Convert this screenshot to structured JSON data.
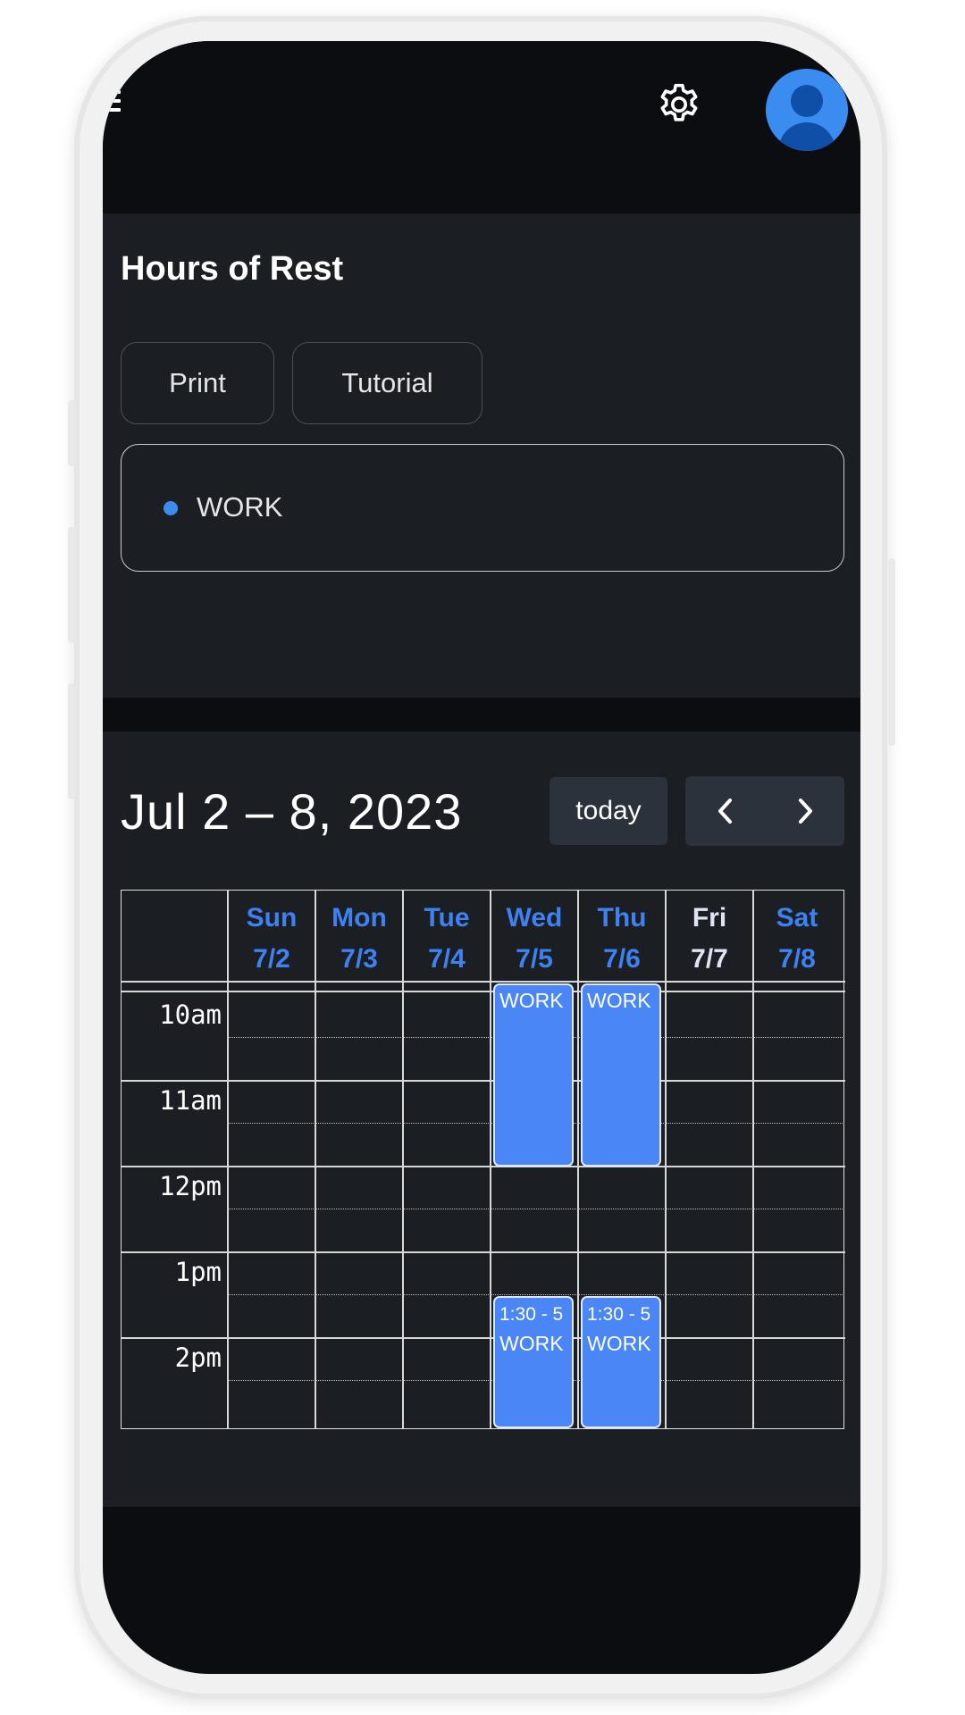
{
  "header": {
    "menu_icon": "hamburger-icon",
    "settings_icon": "gear-icon",
    "avatar_icon": "user-avatar-icon"
  },
  "page": {
    "title": "Hours of Rest",
    "buttons": {
      "print": "Print",
      "tutorial": "Tutorial"
    },
    "legend": [
      {
        "label": "WORK",
        "color": "#3d8bf2"
      }
    ]
  },
  "calendar": {
    "range_title": "Jul 2 – 8, 2023",
    "today_label": "today",
    "prev_icon": "chevron-left-icon",
    "next_icon": "chevron-right-icon",
    "days": [
      {
        "name": "Sun",
        "date": "7/2"
      },
      {
        "name": "Mon",
        "date": "7/3"
      },
      {
        "name": "Tue",
        "date": "7/4"
      },
      {
        "name": "Wed",
        "date": "7/5"
      },
      {
        "name": "Thu",
        "date": "7/6"
      },
      {
        "name": "Fri",
        "date": "7/7",
        "today": true
      },
      {
        "name": "Sat",
        "date": "7/8"
      }
    ],
    "time_labels": [
      "10am",
      "11am",
      "12pm",
      "1pm",
      "2pm"
    ],
    "events": [
      {
        "day": "Wed",
        "label": "WORK"
      },
      {
        "day": "Thu",
        "label": "WORK"
      },
      {
        "day": "Wed",
        "time": "1:30 - 5",
        "label": "WORK"
      },
      {
        "day": "Thu",
        "time": "1:30 - 5",
        "label": "WORK"
      }
    ],
    "event_color": "#4a86f5"
  }
}
